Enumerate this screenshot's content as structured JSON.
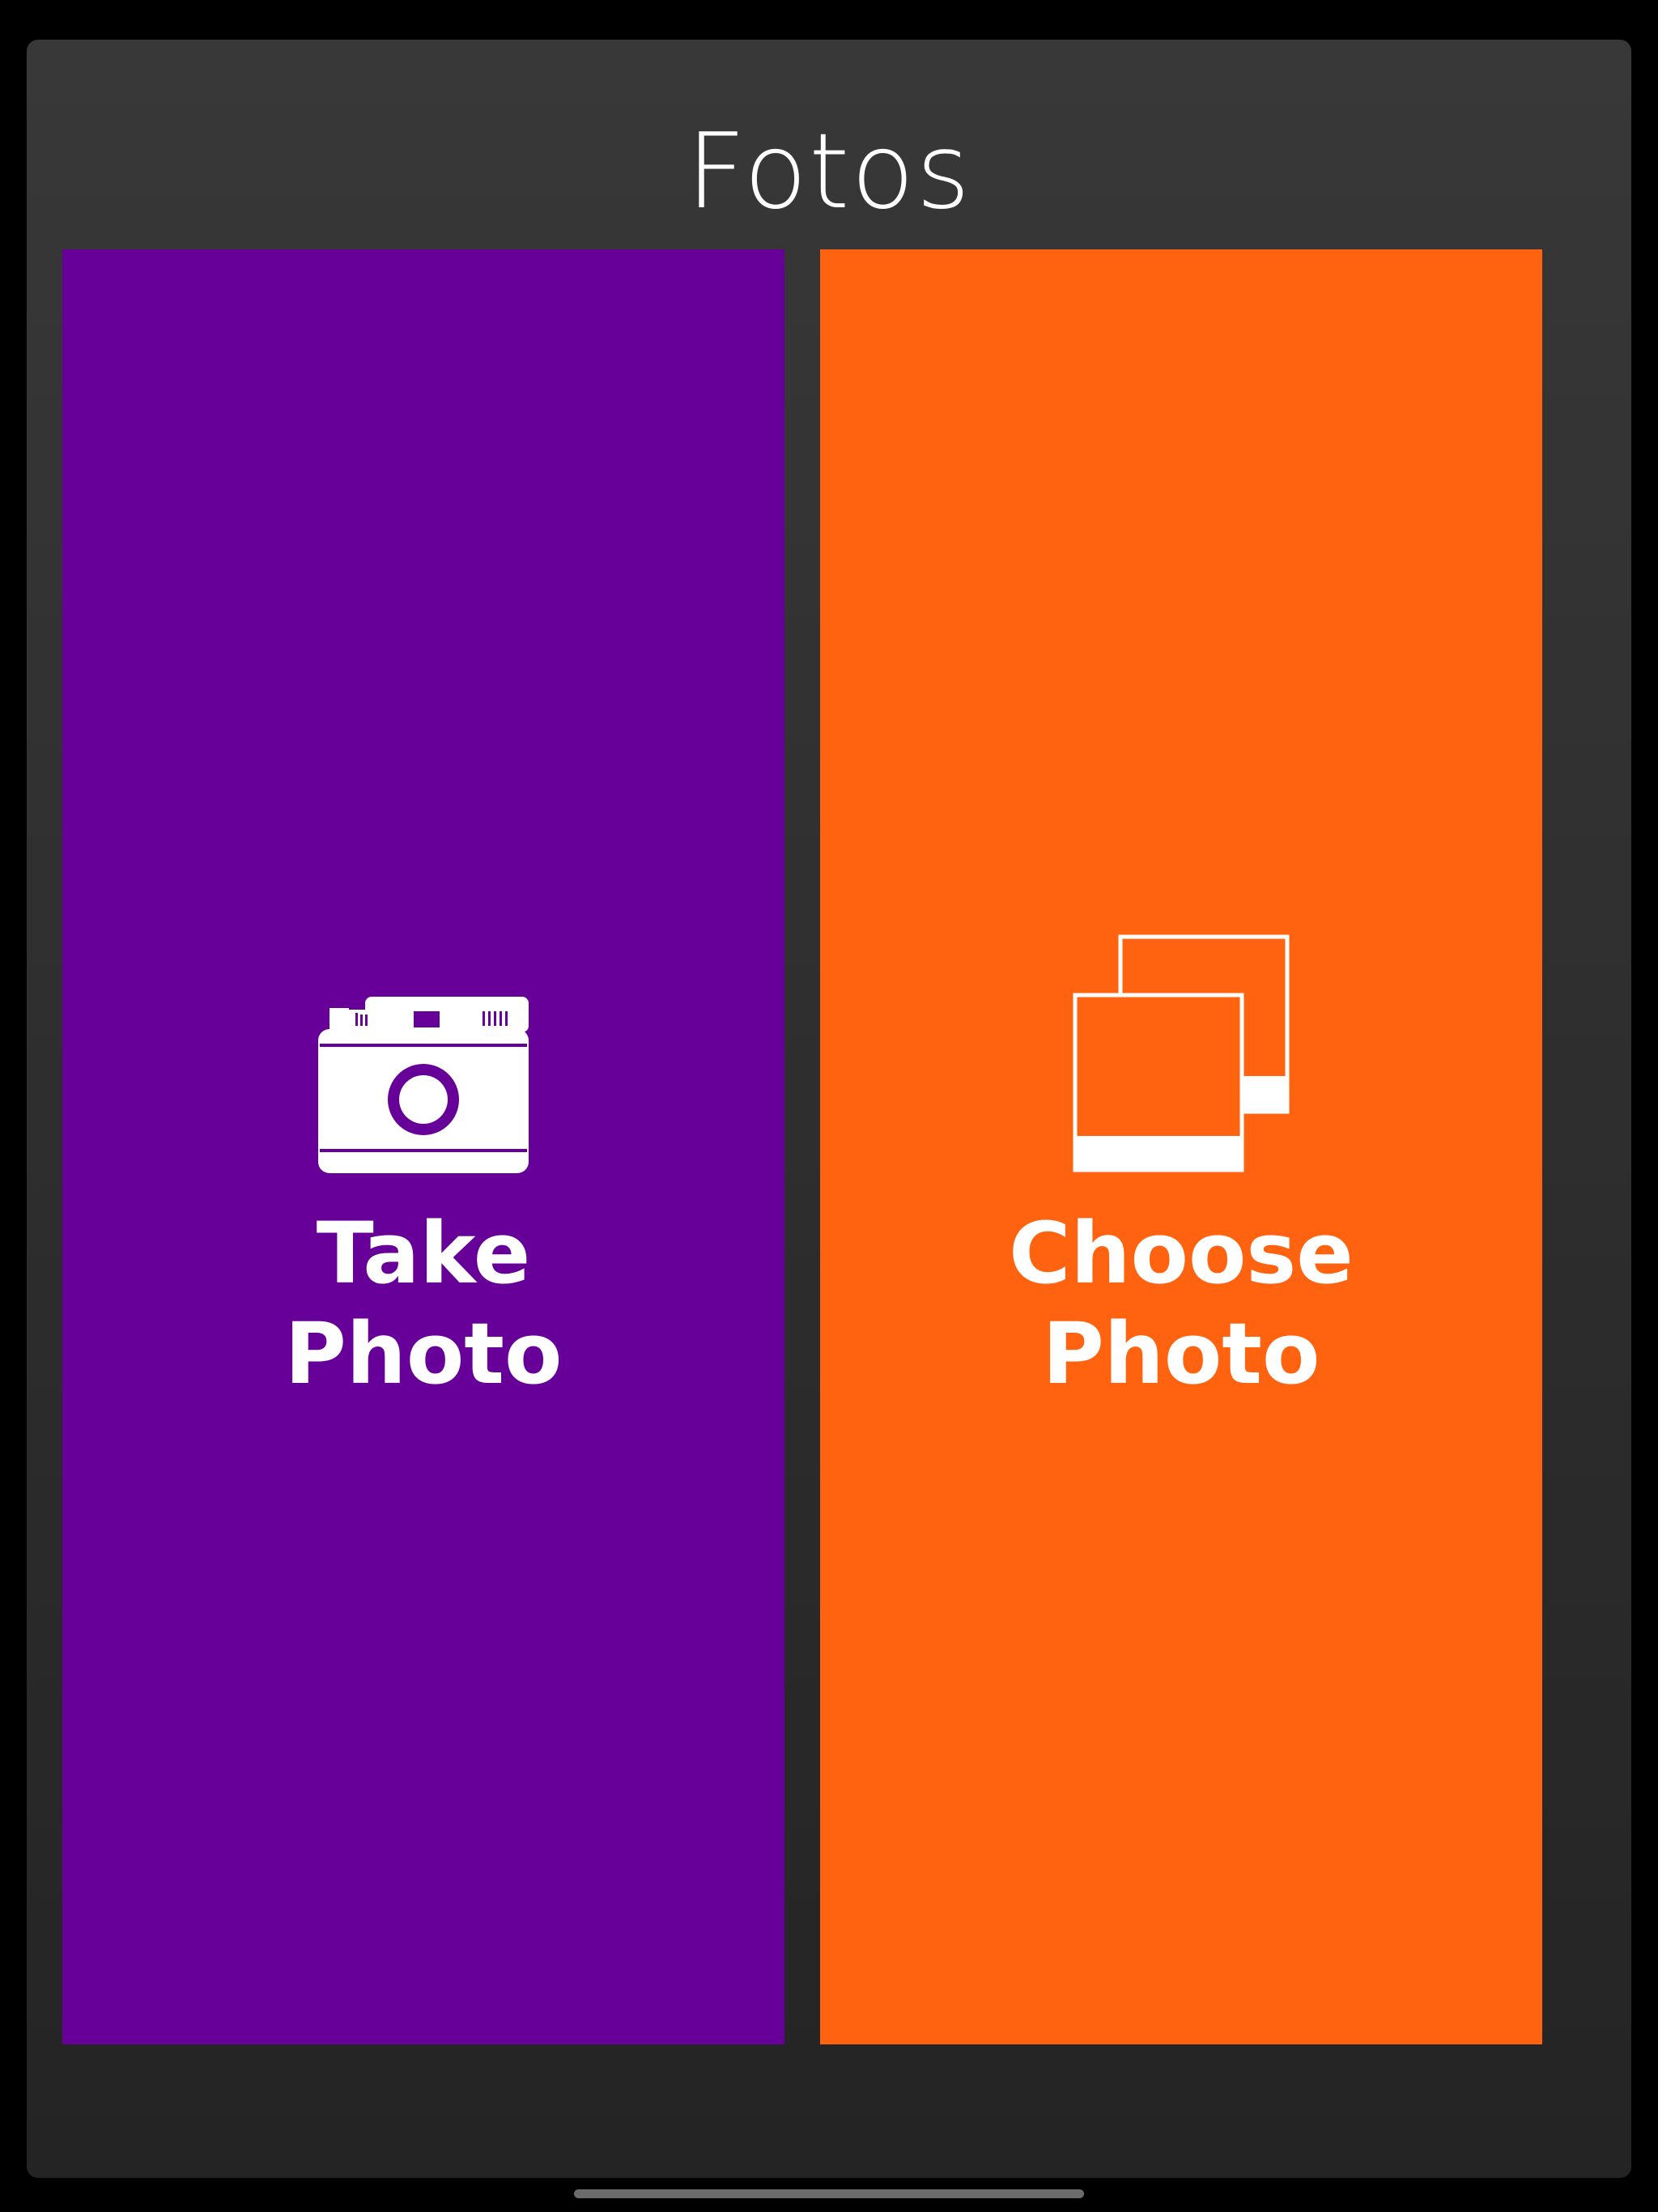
{
  "header": {
    "title": "Fotos"
  },
  "tiles": {
    "take": {
      "line1": "Take",
      "line2": "Photo",
      "icon": "camera-icon",
      "color": "#660099"
    },
    "choose": {
      "line1": "Choose",
      "line2": "Photo",
      "icon": "photo-stack-icon",
      "color": "#ff6310"
    }
  },
  "colors": {
    "background": "#000000",
    "panel_top": "#383838",
    "panel_bottom": "#242424",
    "text": "#ffffff"
  }
}
